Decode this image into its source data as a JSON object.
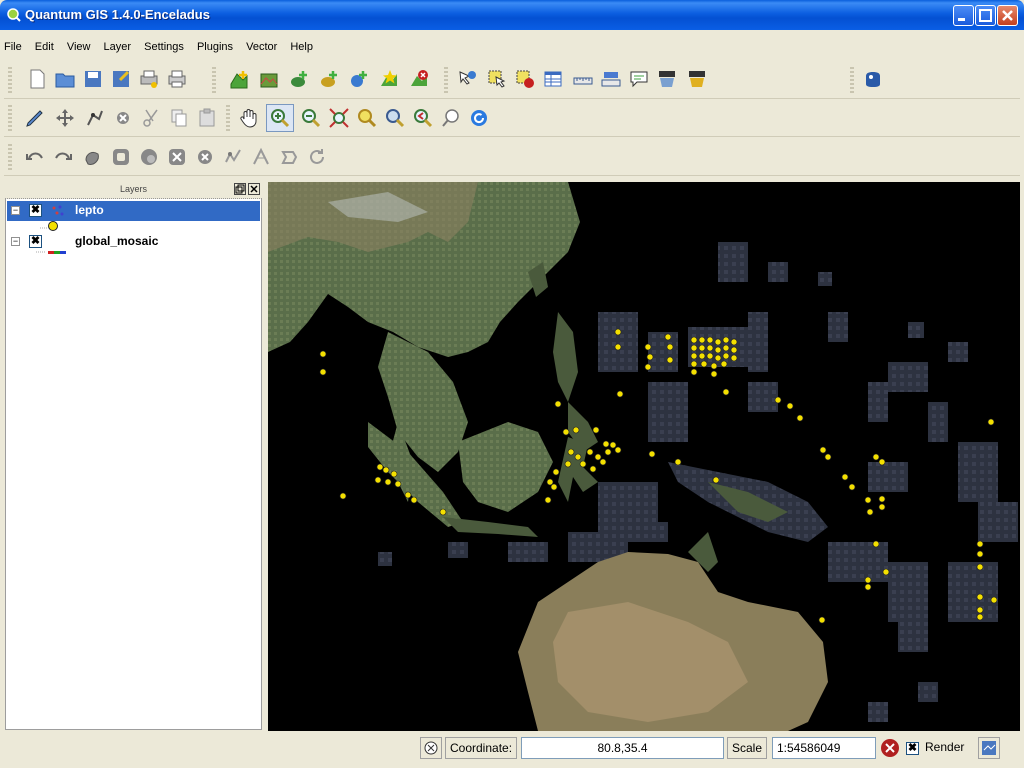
{
  "window": {
    "title": "Quantum GIS 1.4.0-Enceladus"
  },
  "menu": [
    "File",
    "Edit",
    "View",
    "Layer",
    "Settings",
    "Plugins",
    "Vector",
    "Help"
  ],
  "layers_panel": {
    "title": "Layers",
    "layers": [
      {
        "name": "lepto",
        "checked": "✖",
        "expander": "−",
        "selected": true
      },
      {
        "name": "global_mosaic",
        "checked": "✖",
        "expander": "−",
        "selected": false
      }
    ]
  },
  "statusbar": {
    "coordinate_label": "Coordinate:",
    "coordinate_value": "80.8,35.4",
    "scale_label": "Scale",
    "scale_value": "1:54586049",
    "render_label": "Render",
    "render_check": "✖"
  },
  "colors": {
    "point": "#f4e000",
    "selection": "#316ac5",
    "titlebar": "#0b5ee0"
  }
}
